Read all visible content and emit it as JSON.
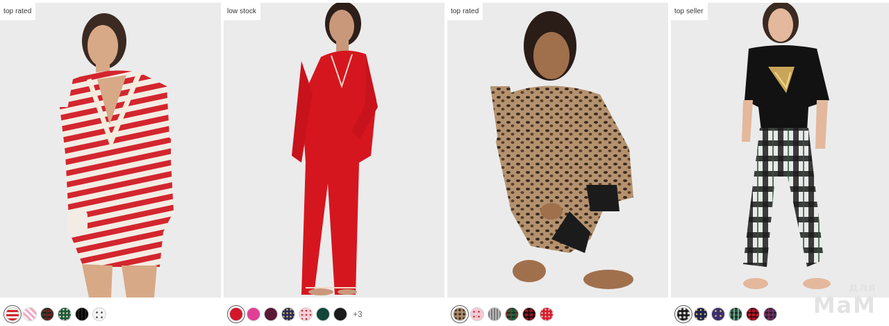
{
  "products": [
    {
      "badge": "top rated",
      "image_desc_icon": "model-striped-romper",
      "swatches": [
        {
          "name": "red-white-stripe",
          "color": "#d2232a",
          "pattern": "stripe",
          "selected": true
        },
        {
          "name": "pink-plaid",
          "color": "#f1a7c0",
          "pattern": "plaid"
        },
        {
          "name": "red-green-plaid",
          "color": "#7b1b25",
          "pattern": "plaid"
        },
        {
          "name": "green-print",
          "color": "#1f5a3c",
          "pattern": "dots"
        },
        {
          "name": "black-white-check",
          "color": "#222222",
          "pattern": "check"
        },
        {
          "name": "white-stars",
          "color": "#f4f4f4",
          "pattern": "stars"
        }
      ],
      "more": ""
    },
    {
      "badge": "low stock",
      "image_desc_icon": "model-red-long-pajama",
      "swatches": [
        {
          "name": "red",
          "color": "#d2162b",
          "pattern": "solid",
          "selected": true
        },
        {
          "name": "pink",
          "color": "#e13f93",
          "pattern": "solid"
        },
        {
          "name": "burgundy",
          "color": "#5a1a35",
          "pattern": "solid"
        },
        {
          "name": "navy-print",
          "color": "#2a2d55",
          "pattern": "dots"
        },
        {
          "name": "light-pink-print",
          "color": "#f6cfd7",
          "pattern": "dots"
        },
        {
          "name": "dark-green",
          "color": "#114638",
          "pattern": "solid"
        },
        {
          "name": "black",
          "color": "#1b1b1b",
          "pattern": "solid"
        }
      ],
      "more": "+3"
    },
    {
      "badge": "top rated",
      "image_desc_icon": "model-leopard-thermal-pajama",
      "swatches": [
        {
          "name": "leopard",
          "color": "#a8896c",
          "pattern": "leopard",
          "selected": true
        },
        {
          "name": "pink-print",
          "color": "#f4c9d2",
          "pattern": "dots"
        },
        {
          "name": "grey-print",
          "color": "#9a9a9a",
          "pattern": "check"
        },
        {
          "name": "green-plaid",
          "color": "#1c5c3a",
          "pattern": "plaid"
        },
        {
          "name": "red-black-plaid",
          "color": "#8e1622",
          "pattern": "plaid"
        },
        {
          "name": "red-print",
          "color": "#d51f2b",
          "pattern": "dots"
        }
      ],
      "more": ""
    },
    {
      "badge": "top seller",
      "image_desc_icon": "model-black-tee-plaid-pants",
      "swatches": [
        {
          "name": "black-white-plaid",
          "color": "#2c2c2c",
          "pattern": "check",
          "selected": true
        },
        {
          "name": "navy-print",
          "color": "#1f2450",
          "pattern": "dots"
        },
        {
          "name": "purple-print",
          "color": "#3c3070",
          "pattern": "dots"
        },
        {
          "name": "green-plaid",
          "color": "#205a40",
          "pattern": "plaid"
        },
        {
          "name": "red-plaid",
          "color": "#b0182a",
          "pattern": "plaid"
        },
        {
          "name": "purple-plaid",
          "color": "#4a2f63",
          "pattern": "plaid"
        }
      ],
      "more": ""
    }
  ],
  "watermark": {
    "line1": "для",
    "line2": "МаМ"
  }
}
